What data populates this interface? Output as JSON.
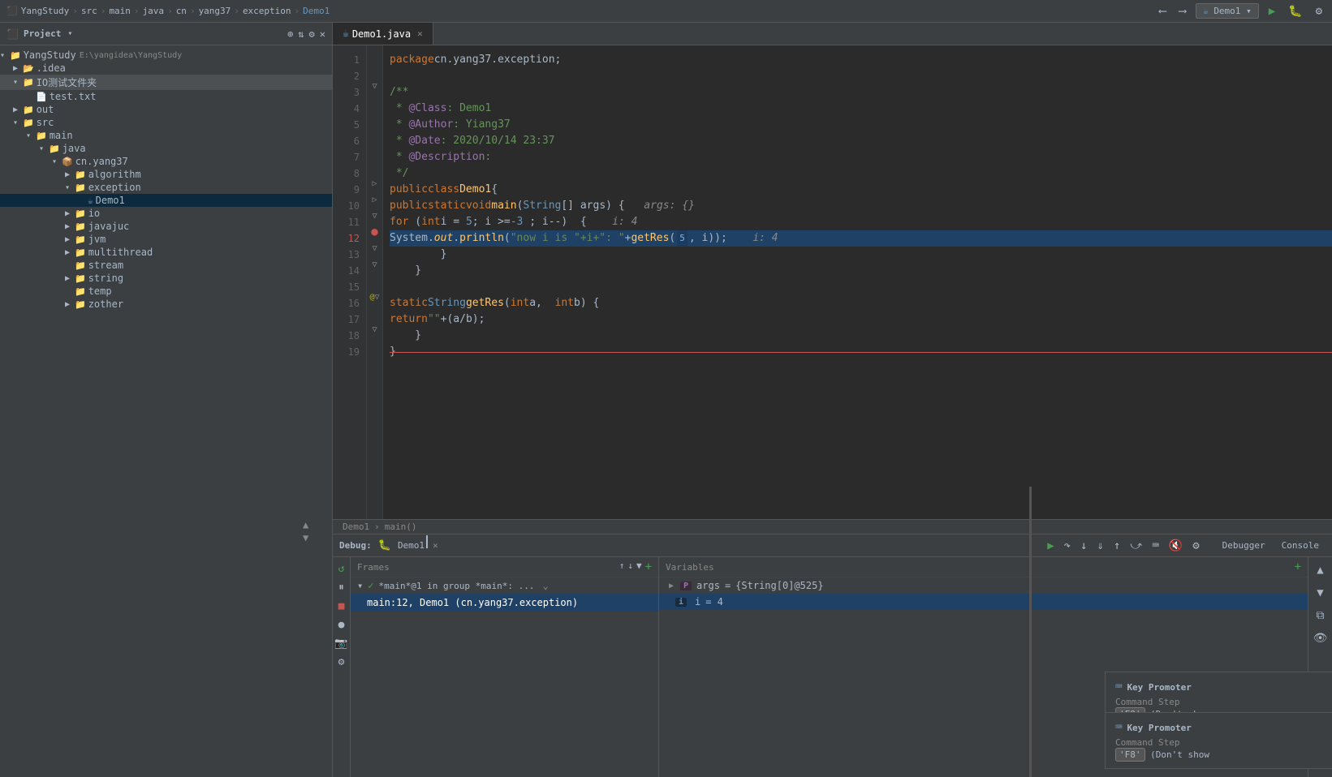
{
  "topbar": {
    "breadcrumb": [
      "YangStudy",
      "src",
      "main",
      "java",
      "cn",
      "yang37",
      "exception",
      "Demo1"
    ],
    "run_config": "Demo1",
    "icons": [
      "back",
      "forward",
      "run",
      "debug",
      "more"
    ]
  },
  "sidebar": {
    "title": "Project",
    "root": {
      "name": "YangStudy",
      "path": "E:\\yangidea\\YangStudy",
      "children": [
        {
          "id": "idea",
          "label": ".idea",
          "type": "folder",
          "expanded": false
        },
        {
          "id": "iotestdir",
          "label": "IO测试文件夹",
          "type": "folder",
          "expanded": true,
          "children": [
            {
              "id": "testtxt",
              "label": "test.txt",
              "type": "txt"
            }
          ]
        },
        {
          "id": "out",
          "label": "out",
          "type": "folder",
          "expanded": false
        },
        {
          "id": "src",
          "label": "src",
          "type": "folder",
          "expanded": true,
          "children": [
            {
              "id": "main",
              "label": "main",
              "type": "folder",
              "expanded": true,
              "children": [
                {
                  "id": "java",
                  "label": "java",
                  "type": "folder",
                  "expanded": true,
                  "children": [
                    {
                      "id": "cnyang37",
                      "label": "cn.yang37",
                      "type": "package",
                      "expanded": true,
                      "children": [
                        {
                          "id": "algorithm",
                          "label": "algorithm",
                          "type": "folder",
                          "expanded": false
                        },
                        {
                          "id": "exception",
                          "label": "exception",
                          "type": "folder",
                          "expanded": true,
                          "children": [
                            {
                              "id": "demo1",
                              "label": "Demo1",
                              "type": "java",
                              "active": true
                            }
                          ]
                        },
                        {
                          "id": "io",
                          "label": "io",
                          "type": "folder",
                          "expanded": false
                        },
                        {
                          "id": "javajuc",
                          "label": "javajuc",
                          "type": "folder",
                          "expanded": false
                        },
                        {
                          "id": "jvm",
                          "label": "jvm",
                          "type": "folder",
                          "expanded": false
                        },
                        {
                          "id": "multithread",
                          "label": "multithread",
                          "type": "folder",
                          "expanded": false
                        },
                        {
                          "id": "stream",
                          "label": "stream",
                          "type": "folder",
                          "expanded": false
                        },
                        {
                          "id": "string",
                          "label": "string",
                          "type": "folder",
                          "expanded": false
                        },
                        {
                          "id": "temp",
                          "label": "temp",
                          "type": "folder",
                          "expanded": false
                        },
                        {
                          "id": "zother",
                          "label": "zother",
                          "type": "folder",
                          "expanded": false
                        }
                      ]
                    }
                  ]
                }
              ]
            }
          ]
        }
      ]
    }
  },
  "editor": {
    "tab_label": "Demo1.java",
    "lines": [
      {
        "num": 1,
        "content": "package_cn_yang37_exception;"
      },
      {
        "num": 2,
        "content": ""
      },
      {
        "num": 3,
        "content": "/**"
      },
      {
        "num": 4,
        "content": " * @Class: Demo1"
      },
      {
        "num": 5,
        "content": " * @Author: Yiang37"
      },
      {
        "num": 6,
        "content": " * @Date: 2020/10/14 23:37"
      },
      {
        "num": 7,
        "content": " * @Description:"
      },
      {
        "num": 8,
        "content": " */"
      },
      {
        "num": 9,
        "content": "public_class_Demo1_{"
      },
      {
        "num": 10,
        "content": "  public_static_void_main_args"
      },
      {
        "num": 11,
        "content": "    for_int_i_5_-3_i--"
      },
      {
        "num": 12,
        "content": "      System.out.println_getRes_5_i_i4"
      },
      {
        "num": 13,
        "content": "    }"
      },
      {
        "num": 14,
        "content": "  }"
      },
      {
        "num": 15,
        "content": ""
      },
      {
        "num": 16,
        "content": "  static_String_getRes_int_a_int_b"
      },
      {
        "num": 17,
        "content": "    return_a_b"
      },
      {
        "num": 18,
        "content": "  }"
      },
      {
        "num": 19,
        "content": "}"
      }
    ],
    "footer_path": "Demo1 › main()"
  },
  "debug": {
    "title": "Debug:",
    "tab_name": "Demo1",
    "tabs": [
      "Debugger",
      "Console"
    ],
    "toolbar_btns": [
      "resume",
      "step-over",
      "step-into",
      "step-out",
      "evaluate",
      "mute-breakpoints",
      "settings"
    ],
    "frames_header": "Frames",
    "vars_header": "Variables",
    "thread_label": "*main*@1 in group *main*: ...",
    "active_frame": "main:12, Demo1 (cn.yang37.exception)",
    "vars": [
      {
        "icon": "P",
        "name": "args",
        "value": "{String[0]@525}"
      },
      {
        "icon": "i",
        "name": "i",
        "value": "= 4"
      }
    ]
  },
  "key_promoter_1": {
    "title": "Key Promoter",
    "command": "Command Ste",
    "key": "'F8'",
    "hint": "(Don't sh"
  },
  "key_promoter_2": {
    "title": "Key Promoter",
    "command": "Command Ste",
    "key": "'F8'",
    "hint": "(Don't sh"
  }
}
